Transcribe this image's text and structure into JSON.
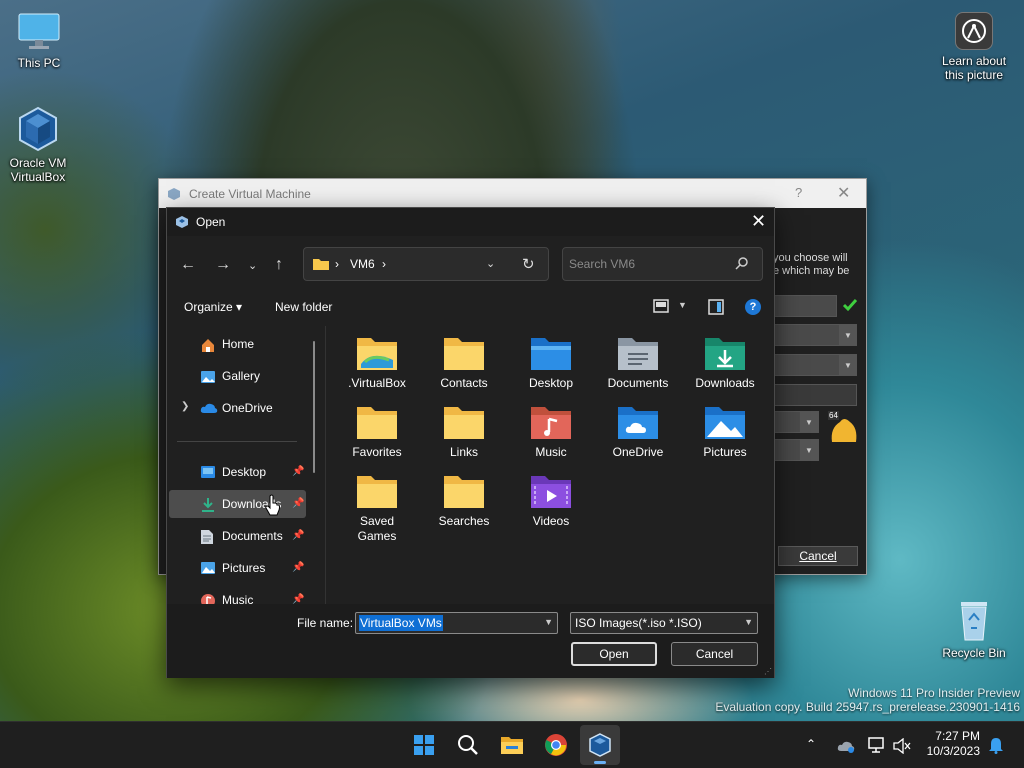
{
  "desktop": {
    "icons": [
      {
        "label": "This PC",
        "icon": "monitor-icon"
      },
      {
        "label": "Oracle VM VirtualBox",
        "icon": "virtualbox-icon"
      },
      {
        "label": "Learn about this picture",
        "icon": "camera-icon"
      },
      {
        "label": "Recycle Bin",
        "icon": "recycle-bin-icon"
      }
    ],
    "watermark": {
      "line1": "Windows 11 Pro Insider Preview",
      "line2": "Evaluation copy. Build 25947.rs_prerelease.230901-1416"
    }
  },
  "background_dialog": {
    "title": "Create Virtual Machine",
    "help_label": "?",
    "close_label": "✕",
    "text_line1": "you choose will",
    "text_line2": "e which may be",
    "badge_label": "64",
    "cancel_label": "Cancel"
  },
  "open_dialog": {
    "title": "Open",
    "close_label": "✕",
    "breadcrumb": {
      "folder": "VM6",
      "separator": "›"
    },
    "search": {
      "placeholder": "Search VM6"
    },
    "toolbar": {
      "organize": "Organize ▾",
      "new_folder": "New folder",
      "help": "?"
    },
    "nav": [
      {
        "label": "Home",
        "icon": "home-icon",
        "pinned": false
      },
      {
        "label": "Gallery",
        "icon": "gallery-icon",
        "pinned": false
      },
      {
        "label": "OneDrive",
        "icon": "cloud-icon",
        "pinned": false,
        "expandable": true
      },
      {
        "label": "Desktop",
        "icon": "desktop-folder-icon",
        "pinned": true
      },
      {
        "label": "Downloads",
        "icon": "download-icon",
        "pinned": true,
        "selected": true
      },
      {
        "label": "Documents",
        "icon": "document-icon",
        "pinned": true
      },
      {
        "label": "Pictures",
        "icon": "pictures-icon",
        "pinned": true
      },
      {
        "label": "Music",
        "icon": "music-icon",
        "pinned": true
      }
    ],
    "files": [
      {
        "name": ".VirtualBox",
        "icon": "virtualbox-folder-icon"
      },
      {
        "name": "Contacts",
        "icon": "folder-icon"
      },
      {
        "name": "Desktop",
        "icon": "desktop-folder-icon"
      },
      {
        "name": "Documents",
        "icon": "documents-folder-icon"
      },
      {
        "name": "Downloads",
        "icon": "downloads-folder-icon"
      },
      {
        "name": "Favorites",
        "icon": "folder-icon"
      },
      {
        "name": "Links",
        "icon": "folder-icon"
      },
      {
        "name": "Music",
        "icon": "music-folder-icon"
      },
      {
        "name": "OneDrive",
        "icon": "onedrive-folder-icon"
      },
      {
        "name": "Pictures",
        "icon": "pictures-folder-icon"
      },
      {
        "name": "Saved Games",
        "icon": "folder-icon"
      },
      {
        "name": "Searches",
        "icon": "folder-icon"
      },
      {
        "name": "Videos",
        "icon": "videos-folder-icon"
      }
    ],
    "file_name_label": "File name:",
    "file_name_value": "VirtualBox VMs",
    "file_type_value": "ISO Images(*.iso *.ISO)",
    "open_label": "Open",
    "cancel_label": "Cancel"
  },
  "taskbar": {
    "apps": [
      "start-icon",
      "search-icon",
      "file-explorer-icon",
      "chrome-icon",
      "virtualbox-icon"
    ],
    "clock": {
      "time": "7:27 PM",
      "date": "10/3/2023"
    }
  },
  "colors": {
    "accent": "#0f6fd4",
    "folder_yellow": "#f8c84c",
    "dialog_bg": "#202020"
  }
}
